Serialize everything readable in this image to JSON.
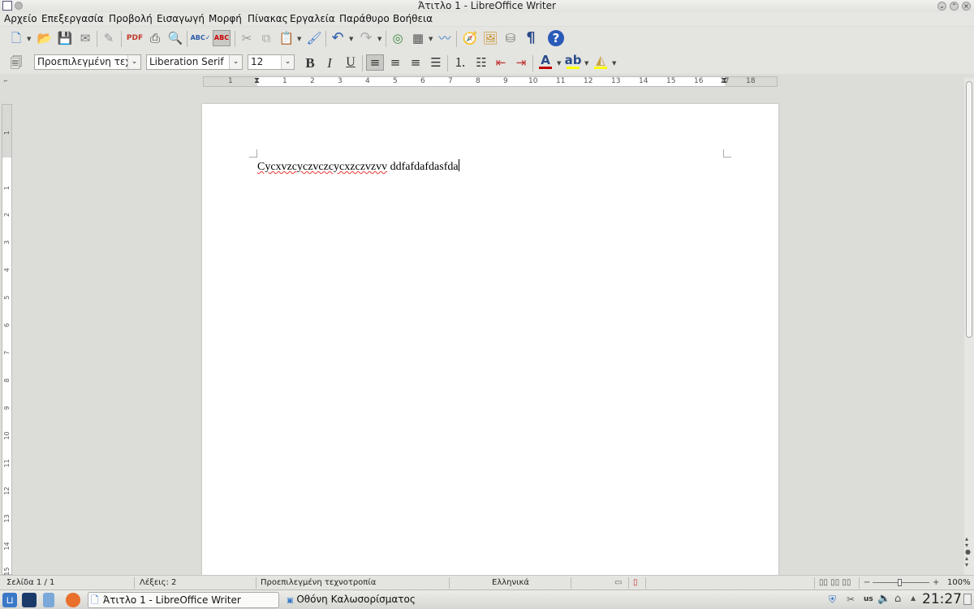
{
  "window": {
    "title": "Άτιτλο 1 - LibreOffice Writer"
  },
  "menu": [
    "Αρχείο",
    "Επεξεργασία",
    "Προβολή",
    "Εισαγωγή",
    "Μορφή",
    "Πίνακας",
    "Εργαλεία",
    "Παράθυρο",
    "Βοήθεια"
  ],
  "formatting": {
    "paragraph_style": "Προεπιλεγμένη τεχνο",
    "font_name": "Liberation Serif",
    "font_size": "12"
  },
  "ruler": {
    "h_ticks": [
      "1",
      "1",
      "2",
      "3",
      "4",
      "5",
      "6",
      "7",
      "8",
      "9",
      "10",
      "11",
      "12",
      "13",
      "14",
      "15",
      "16",
      "17",
      "18"
    ],
    "v_ticks": [
      "1",
      "1",
      "2",
      "3",
      "4",
      "5",
      "6",
      "7",
      "8",
      "9",
      "10",
      "11",
      "12",
      "13",
      "14",
      "15"
    ]
  },
  "document": {
    "word1": "Cycxvzcyczvczcycxzczvzvv",
    "word2": "ddfafdafdasfda"
  },
  "status": {
    "page": "Σελίδα 1 / 1",
    "words": "Λέξεις: 2",
    "style": "Προεπιλεγμένη τεχνοτροπία",
    "language": "Ελληνικά",
    "zoom": "100%"
  },
  "taskbar": {
    "active_window": "Άτιτλο 1 - LibreOffice Writer",
    "second_window": "Οθόνη Καλωσορίσματος",
    "keyboard": "us",
    "clock": "21:27"
  },
  "colors": {
    "font_color": "#c00000",
    "highlight": "#ffff00",
    "accent": "#3a78c8"
  }
}
